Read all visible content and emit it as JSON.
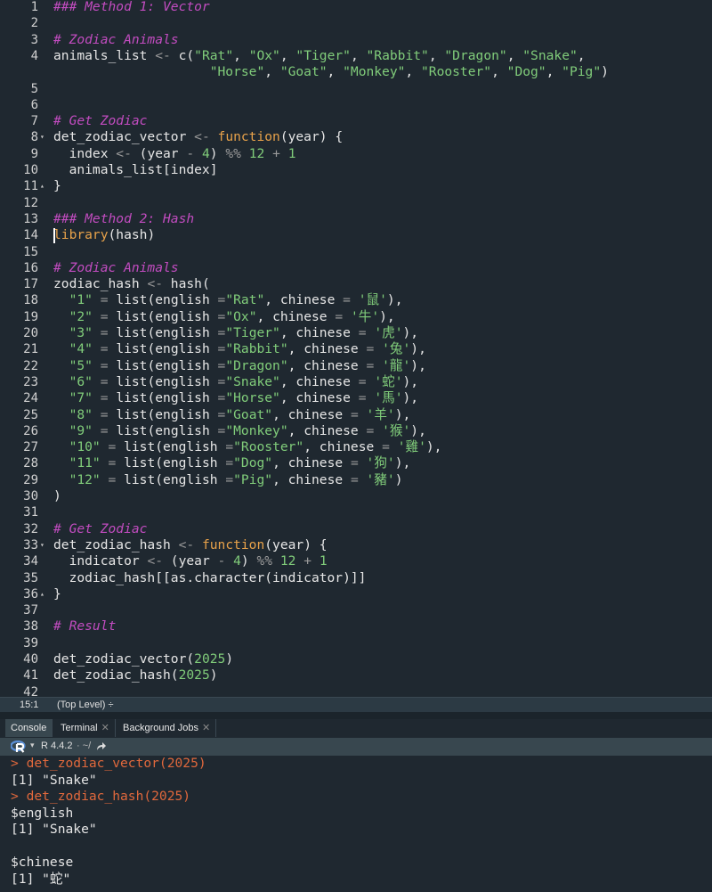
{
  "editor": {
    "lines": [
      {
        "n": "1",
        "tokens": [
          [
            "comment",
            "### Method 1: Vector"
          ]
        ]
      },
      {
        "n": "2",
        "tokens": []
      },
      {
        "n": "3",
        "tokens": [
          [
            "comment",
            "# Zodiac Animals"
          ]
        ]
      },
      {
        "n": "4",
        "tokens": [
          [
            "plain",
            "animals_list "
          ],
          [
            "op",
            "<-"
          ],
          [
            "plain",
            " c("
          ],
          [
            "str",
            "\"Rat\""
          ],
          [
            "plain",
            ", "
          ],
          [
            "str",
            "\"Ox\""
          ],
          [
            "plain",
            ", "
          ],
          [
            "str",
            "\"Tiger\""
          ],
          [
            "plain",
            ", "
          ],
          [
            "str",
            "\"Rabbit\""
          ],
          [
            "plain",
            ", "
          ],
          [
            "str",
            "\"Dragon\""
          ],
          [
            "plain",
            ", "
          ],
          [
            "str",
            "\"Snake\""
          ],
          [
            "plain",
            ","
          ]
        ]
      },
      {
        "n": "",
        "tokens": [
          [
            "plain",
            "                    "
          ],
          [
            "str",
            "\"Horse\""
          ],
          [
            "plain",
            ", "
          ],
          [
            "str",
            "\"Goat\""
          ],
          [
            "plain",
            ", "
          ],
          [
            "str",
            "\"Monkey\""
          ],
          [
            "plain",
            ", "
          ],
          [
            "str",
            "\"Rooster\""
          ],
          [
            "plain",
            ", "
          ],
          [
            "str",
            "\"Dog\""
          ],
          [
            "plain",
            ", "
          ],
          [
            "str",
            "\"Pig\""
          ],
          [
            "plain",
            ")"
          ]
        ]
      },
      {
        "n": "5",
        "tokens": []
      },
      {
        "n": "6",
        "tokens": []
      },
      {
        "n": "7",
        "tokens": [
          [
            "comment",
            "# Get Zodiac"
          ]
        ]
      },
      {
        "n": "8",
        "fold": "▾",
        "tokens": [
          [
            "plain",
            "det_zodiac_vector "
          ],
          [
            "op",
            "<-"
          ],
          [
            "plain",
            " "
          ],
          [
            "kw",
            "function"
          ],
          [
            "plain",
            "(year) {"
          ]
        ]
      },
      {
        "n": "9",
        "tokens": [
          [
            "plain",
            "  index "
          ],
          [
            "op",
            "<-"
          ],
          [
            "plain",
            " (year "
          ],
          [
            "op",
            "-"
          ],
          [
            "plain",
            " "
          ],
          [
            "num",
            "4"
          ],
          [
            "plain",
            ") "
          ],
          [
            "op",
            "%%"
          ],
          [
            "plain",
            " "
          ],
          [
            "num",
            "12"
          ],
          [
            "plain",
            " "
          ],
          [
            "op",
            "+"
          ],
          [
            "plain",
            " "
          ],
          [
            "num",
            "1"
          ]
        ]
      },
      {
        "n": "10",
        "tokens": [
          [
            "plain",
            "  animals_list[index]"
          ]
        ]
      },
      {
        "n": "11",
        "fold": "▴",
        "tokens": [
          [
            "plain",
            "}"
          ]
        ]
      },
      {
        "n": "12",
        "tokens": []
      },
      {
        "n": "13",
        "tokens": [
          [
            "comment",
            "### Method 2: Hash"
          ]
        ]
      },
      {
        "n": "14",
        "tokens": [
          [
            "kw",
            "library"
          ],
          [
            "plain",
            "(hash)"
          ]
        ]
      },
      {
        "n": "15",
        "tokens": []
      },
      {
        "n": "16",
        "tokens": [
          [
            "comment",
            "# Zodiac Animals"
          ]
        ]
      },
      {
        "n": "17",
        "tokens": [
          [
            "plain",
            "zodiac_hash "
          ],
          [
            "op",
            "<-"
          ],
          [
            "plain",
            " hash("
          ]
        ]
      },
      {
        "n": "18",
        "tokens": [
          [
            "plain",
            "  "
          ],
          [
            "str",
            "\"1\""
          ],
          [
            "plain",
            " "
          ],
          [
            "op",
            "="
          ],
          [
            "plain",
            " list(english "
          ],
          [
            "op",
            "="
          ],
          [
            "str",
            "\"Rat\""
          ],
          [
            "plain",
            ", chinese "
          ],
          [
            "op",
            "="
          ],
          [
            "plain",
            " "
          ],
          [
            "cn",
            "'鼠'"
          ],
          [
            "plain",
            "),"
          ]
        ]
      },
      {
        "n": "19",
        "tokens": [
          [
            "plain",
            "  "
          ],
          [
            "str",
            "\"2\""
          ],
          [
            "plain",
            " "
          ],
          [
            "op",
            "="
          ],
          [
            "plain",
            " list(english "
          ],
          [
            "op",
            "="
          ],
          [
            "str",
            "\"Ox\""
          ],
          [
            "plain",
            ", chinese "
          ],
          [
            "op",
            "="
          ],
          [
            "plain",
            " "
          ],
          [
            "cn",
            "'牛'"
          ],
          [
            "plain",
            "),"
          ]
        ]
      },
      {
        "n": "20",
        "tokens": [
          [
            "plain",
            "  "
          ],
          [
            "str",
            "\"3\""
          ],
          [
            "plain",
            " "
          ],
          [
            "op",
            "="
          ],
          [
            "plain",
            " list(english "
          ],
          [
            "op",
            "="
          ],
          [
            "str",
            "\"Tiger\""
          ],
          [
            "plain",
            ", chinese "
          ],
          [
            "op",
            "="
          ],
          [
            "plain",
            " "
          ],
          [
            "cn",
            "'虎'"
          ],
          [
            "plain",
            "),"
          ]
        ]
      },
      {
        "n": "21",
        "tokens": [
          [
            "plain",
            "  "
          ],
          [
            "str",
            "\"4\""
          ],
          [
            "plain",
            " "
          ],
          [
            "op",
            "="
          ],
          [
            "plain",
            " list(english "
          ],
          [
            "op",
            "="
          ],
          [
            "str",
            "\"Rabbit\""
          ],
          [
            "plain",
            ", chinese "
          ],
          [
            "op",
            "="
          ],
          [
            "plain",
            " "
          ],
          [
            "cn",
            "'兔'"
          ],
          [
            "plain",
            "),"
          ]
        ]
      },
      {
        "n": "22",
        "tokens": [
          [
            "plain",
            "  "
          ],
          [
            "str",
            "\"5\""
          ],
          [
            "plain",
            " "
          ],
          [
            "op",
            "="
          ],
          [
            "plain",
            " list(english "
          ],
          [
            "op",
            "="
          ],
          [
            "str",
            "\"Dragon\""
          ],
          [
            "plain",
            ", chinese "
          ],
          [
            "op",
            "="
          ],
          [
            "plain",
            " "
          ],
          [
            "cn",
            "'龍'"
          ],
          [
            "plain",
            "),"
          ]
        ]
      },
      {
        "n": "23",
        "tokens": [
          [
            "plain",
            "  "
          ],
          [
            "str",
            "\"6\""
          ],
          [
            "plain",
            " "
          ],
          [
            "op",
            "="
          ],
          [
            "plain",
            " list(english "
          ],
          [
            "op",
            "="
          ],
          [
            "str",
            "\"Snake\""
          ],
          [
            "plain",
            ", chinese "
          ],
          [
            "op",
            "="
          ],
          [
            "plain",
            " "
          ],
          [
            "cn",
            "'蛇'"
          ],
          [
            "plain",
            "),"
          ]
        ]
      },
      {
        "n": "24",
        "tokens": [
          [
            "plain",
            "  "
          ],
          [
            "str",
            "\"7\""
          ],
          [
            "plain",
            " "
          ],
          [
            "op",
            "="
          ],
          [
            "plain",
            " list(english "
          ],
          [
            "op",
            "="
          ],
          [
            "str",
            "\"Horse\""
          ],
          [
            "plain",
            ", chinese "
          ],
          [
            "op",
            "="
          ],
          [
            "plain",
            " "
          ],
          [
            "cn",
            "'馬'"
          ],
          [
            "plain",
            "),"
          ]
        ]
      },
      {
        "n": "25",
        "tokens": [
          [
            "plain",
            "  "
          ],
          [
            "str",
            "\"8\""
          ],
          [
            "plain",
            " "
          ],
          [
            "op",
            "="
          ],
          [
            "plain",
            " list(english "
          ],
          [
            "op",
            "="
          ],
          [
            "str",
            "\"Goat\""
          ],
          [
            "plain",
            ", chinese "
          ],
          [
            "op",
            "="
          ],
          [
            "plain",
            " "
          ],
          [
            "cn",
            "'羊'"
          ],
          [
            "plain",
            "),"
          ]
        ]
      },
      {
        "n": "26",
        "tokens": [
          [
            "plain",
            "  "
          ],
          [
            "str",
            "\"9\""
          ],
          [
            "plain",
            " "
          ],
          [
            "op",
            "="
          ],
          [
            "plain",
            " list(english "
          ],
          [
            "op",
            "="
          ],
          [
            "str",
            "\"Monkey\""
          ],
          [
            "plain",
            ", chinese "
          ],
          [
            "op",
            "="
          ],
          [
            "plain",
            " "
          ],
          [
            "cn",
            "'猴'"
          ],
          [
            "plain",
            "),"
          ]
        ]
      },
      {
        "n": "27",
        "tokens": [
          [
            "plain",
            "  "
          ],
          [
            "str",
            "\"10\""
          ],
          [
            "plain",
            " "
          ],
          [
            "op",
            "="
          ],
          [
            "plain",
            " list(english "
          ],
          [
            "op",
            "="
          ],
          [
            "str",
            "\"Rooster\""
          ],
          [
            "plain",
            ", chinese "
          ],
          [
            "op",
            "="
          ],
          [
            "plain",
            " "
          ],
          [
            "cn",
            "'雞'"
          ],
          [
            "plain",
            "),"
          ]
        ]
      },
      {
        "n": "28",
        "tokens": [
          [
            "plain",
            "  "
          ],
          [
            "str",
            "\"11\""
          ],
          [
            "plain",
            " "
          ],
          [
            "op",
            "="
          ],
          [
            "plain",
            " list(english "
          ],
          [
            "op",
            "="
          ],
          [
            "str",
            "\"Dog\""
          ],
          [
            "plain",
            ", chinese "
          ],
          [
            "op",
            "="
          ],
          [
            "plain",
            " "
          ],
          [
            "cn",
            "'狗'"
          ],
          [
            "plain",
            "),"
          ]
        ]
      },
      {
        "n": "29",
        "tokens": [
          [
            "plain",
            "  "
          ],
          [
            "str",
            "\"12\""
          ],
          [
            "plain",
            " "
          ],
          [
            "op",
            "="
          ],
          [
            "plain",
            " list(english "
          ],
          [
            "op",
            "="
          ],
          [
            "str",
            "\"Pig\""
          ],
          [
            "plain",
            ", chinese "
          ],
          [
            "op",
            "="
          ],
          [
            "plain",
            " "
          ],
          [
            "cn",
            "'豬'"
          ],
          [
            "plain",
            ")"
          ]
        ]
      },
      {
        "n": "30",
        "tokens": [
          [
            "plain",
            ")"
          ]
        ]
      },
      {
        "n": "31",
        "tokens": []
      },
      {
        "n": "32",
        "tokens": [
          [
            "comment",
            "# Get Zodiac"
          ]
        ]
      },
      {
        "n": "33",
        "fold": "▾",
        "tokens": [
          [
            "plain",
            "det_zodiac_hash "
          ],
          [
            "op",
            "<-"
          ],
          [
            "plain",
            " "
          ],
          [
            "kw",
            "function"
          ],
          [
            "plain",
            "(year) {"
          ]
        ]
      },
      {
        "n": "34",
        "tokens": [
          [
            "plain",
            "  indicator "
          ],
          [
            "op",
            "<-"
          ],
          [
            "plain",
            " (year "
          ],
          [
            "op",
            "-"
          ],
          [
            "plain",
            " "
          ],
          [
            "num",
            "4"
          ],
          [
            "plain",
            ") "
          ],
          [
            "op",
            "%%"
          ],
          [
            "plain",
            " "
          ],
          [
            "num",
            "12"
          ],
          [
            "plain",
            " "
          ],
          [
            "op",
            "+"
          ],
          [
            "plain",
            " "
          ],
          [
            "num",
            "1"
          ]
        ]
      },
      {
        "n": "35",
        "tokens": [
          [
            "plain",
            "  zodiac_hash[[as.character(indicator)]]"
          ]
        ]
      },
      {
        "n": "36",
        "fold": "▴",
        "tokens": [
          [
            "plain",
            "}"
          ]
        ]
      },
      {
        "n": "37",
        "tokens": []
      },
      {
        "n": "38",
        "tokens": [
          [
            "comment",
            "# Result"
          ]
        ]
      },
      {
        "n": "39",
        "tokens": []
      },
      {
        "n": "40",
        "tokens": [
          [
            "plain",
            "det_zodiac_vector("
          ],
          [
            "num",
            "2025"
          ],
          [
            "plain",
            ")"
          ]
        ]
      },
      {
        "n": "41",
        "tokens": [
          [
            "plain",
            "det_zodiac_hash("
          ],
          [
            "num",
            "2025"
          ],
          [
            "plain",
            ")"
          ]
        ]
      },
      {
        "n": "42",
        "tokens": []
      },
      {
        "n": "43",
        "tokens": []
      }
    ]
  },
  "status_bar": {
    "cursor_position": "15:1",
    "scope": "(Top Level) ÷"
  },
  "tabs": [
    {
      "label": "Console",
      "closable": false,
      "active": true
    },
    {
      "label": "Terminal",
      "closable": true,
      "active": false
    },
    {
      "label": "Background Jobs",
      "closable": true,
      "active": false
    }
  ],
  "console_toolbar": {
    "r_version": "R 4.4.2",
    "path": "· ~/"
  },
  "console": {
    "lines": [
      {
        "type": "prompt",
        "text": "> det_zodiac_vector(2025)"
      },
      {
        "type": "out",
        "text": "[1] \"Snake\""
      },
      {
        "type": "prompt",
        "text": "> det_zodiac_hash(2025)"
      },
      {
        "type": "out",
        "text": "$english"
      },
      {
        "type": "out",
        "text": "[1] \"Snake\""
      },
      {
        "type": "out",
        "text": ""
      },
      {
        "type": "out",
        "text": "$chinese"
      },
      {
        "type": "out",
        "text": "[1] \"蛇\""
      }
    ]
  },
  "colors": {
    "background": "#1f2830",
    "comment": "#c24cc0",
    "string": "#80cc7a",
    "keyword": "#e8a24a",
    "console_prompt": "#e0683c"
  }
}
